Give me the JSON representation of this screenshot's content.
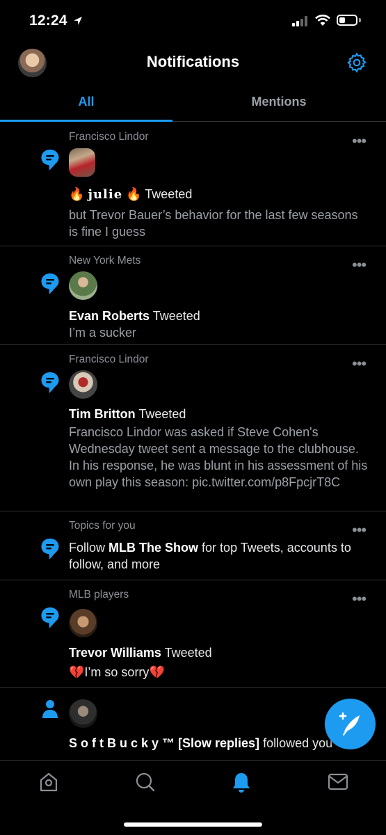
{
  "status_bar": {
    "time": "12:24",
    "battery_level": 0.35
  },
  "header": {
    "title": "Notifications",
    "settings_icon": "gear-icon"
  },
  "tabs": [
    {
      "label": "All",
      "selected": true
    },
    {
      "label": "Mentions",
      "selected": false
    }
  ],
  "notifications": [
    {
      "source": "Francisco Lindor",
      "icon": "tweet-bubble-icon",
      "author_emoji_left": "🔥",
      "author": "julie",
      "author_emoji_right": "🔥",
      "action": "Tweeted",
      "text": "but Trevor Bauer’s behavior for the last few seasons is fine I guess"
    },
    {
      "source": "New York Mets",
      "icon": "tweet-bubble-icon",
      "author": "Evan Roberts",
      "action": "Tweeted",
      "text": "I’m a sucker"
    },
    {
      "source": "Francisco Lindor",
      "icon": "tweet-bubble-icon",
      "author": "Tim Britton",
      "action": "Tweeted",
      "text": "Francisco Lindor was asked if Steve Cohen's Wednesday tweet sent a message to the clubhouse. In his response, he was blunt in his assessment of his own play this season: pic.twitter.com/p8FpcjrT8C"
    },
    {
      "source": "Topics for you",
      "icon": "tweet-bubble-icon",
      "text_prefix": "Follow",
      "topic": "MLB The Show",
      "text_suffix": "for top Tweets, accounts to follow, and more"
    },
    {
      "source": "MLB players",
      "icon": "tweet-bubble-icon",
      "author": "Trevor Williams",
      "action": "Tweeted",
      "text_emoji_left": "💔",
      "text": "I’m so sorry",
      "text_emoji_right": "💔"
    },
    {
      "icon": "person-icon",
      "author": "S o f t B u c k y ™ [Slow replies]",
      "action": "followed you"
    }
  ],
  "fab": {
    "icon": "compose-tweet-icon"
  },
  "bottom_nav": [
    {
      "icon": "home-icon",
      "selected": false
    },
    {
      "icon": "search-icon",
      "selected": false
    },
    {
      "icon": "notifications-bell-icon",
      "selected": true
    },
    {
      "icon": "messages-envelope-icon",
      "selected": false
    }
  ],
  "colors": {
    "accent": "#1d9bf0",
    "background": "#000000",
    "secondary_text": "#9aa0a6",
    "divider": "#2f3336"
  }
}
